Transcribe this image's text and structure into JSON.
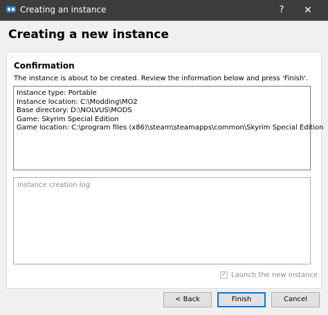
{
  "window": {
    "title": "Creating an instance",
    "help_label": "?",
    "close_label": "✕",
    "icon": "app-icon"
  },
  "page": {
    "title": "Creating a new instance"
  },
  "confirmation": {
    "heading": "Confirmation",
    "description": "The instance is about to be created. Review the information below and press 'Finish'.",
    "details": [
      "Instance type: Portable",
      "Instance location: C:\\Modding\\MO2",
      "Base directory: D:\\NOLVUS\\MODS",
      "Game: Skyrim Special Edition",
      "Game location: C:\\program files (x86)\\steam\\steamapps\\common\\Skyrim Special Edition"
    ]
  },
  "log": {
    "placeholder": "Instance creation log"
  },
  "launch": {
    "label": "Launch the new instance",
    "checked": true,
    "enabled": false
  },
  "buttons": {
    "back": "< Back",
    "finish": "Finish",
    "cancel": "Cancel"
  },
  "colors": {
    "titlebar": "#3d3d3d",
    "accent": "#0078d7",
    "app_icon": "#2f7fd8"
  }
}
